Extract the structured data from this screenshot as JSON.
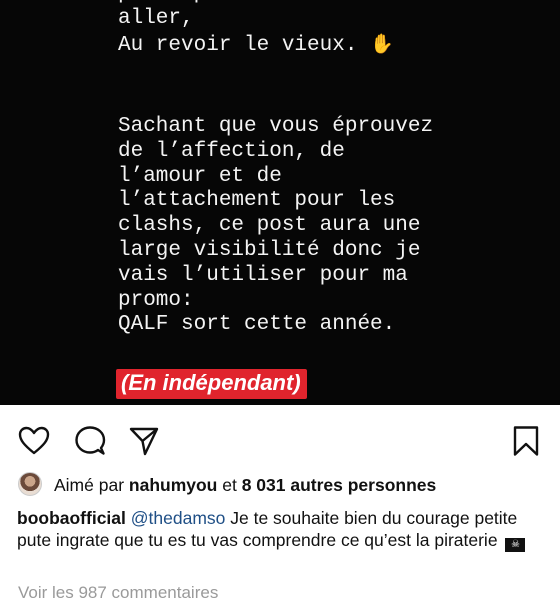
{
  "story": {
    "top_lines": "principes vont s’en\naller,\nAu revoir le vieux.",
    "hand_emoji": "✋",
    "body_lines": "Sachant que vous éprouvez\nde l’affection, de\nl’amour et de\nl’attachement pour les\nclashs, ce post aura une\nlarge visibilité donc je\nvais l’utiliser pour ma\npromo:\nQALF sort cette année.",
    "highlight": "(En indépendant)",
    "highlight_color": "#e0242d"
  },
  "actions": {
    "like_icon": "heart-icon",
    "comment_icon": "comment-icon",
    "share_icon": "send-icon",
    "save_icon": "bookmark-icon"
  },
  "likes": {
    "prefix": "Aimé par ",
    "user": "nahumyou",
    "middle": " et ",
    "count": "8 031 autres personnes"
  },
  "caption": {
    "username": "boobaofficial",
    "mention": "@thedamso",
    "text": " Je te souhaite bien du courage petite pute ingrate que tu es tu vas comprendre ce qu’est la piraterie",
    "emoji": "☠"
  },
  "comments_link": "Voir les 987 commentaires"
}
